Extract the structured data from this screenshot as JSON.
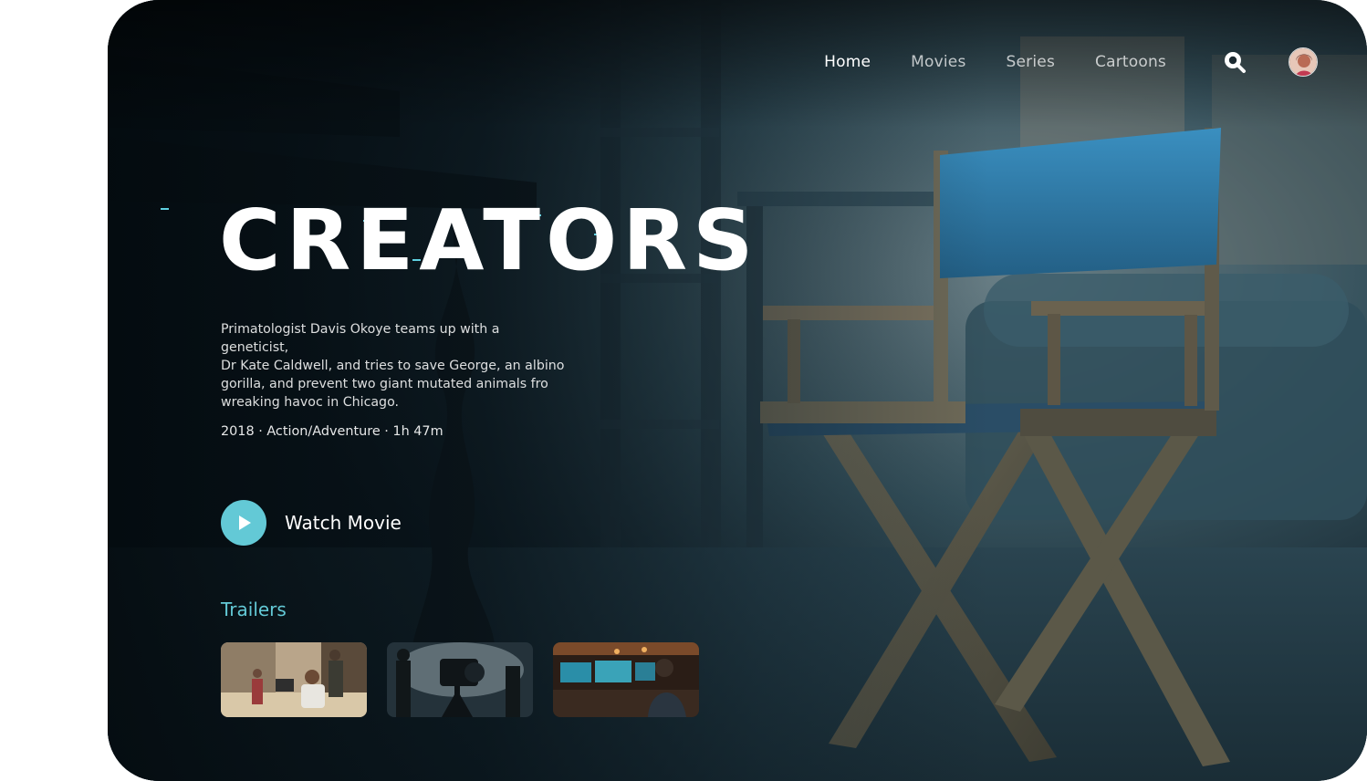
{
  "nav": {
    "items": [
      {
        "label": "Home",
        "active": true
      },
      {
        "label": "Movies",
        "active": false
      },
      {
        "label": "Series",
        "active": false
      },
      {
        "label": "Cartoons",
        "active": false
      }
    ],
    "search_icon": "search-icon",
    "avatar_icon": "user-avatar"
  },
  "hero": {
    "title": "CREATORS",
    "synopsis": "Primatologist Davis Okoye teams up with a geneticist,\nDr Kate Caldwell, and tries to save George, an albino\ngorilla, and prevent two giant mutated animals fro\n wreaking havoc in Chicago.",
    "meta": "2018 · Action/Adventure · 1h 47m",
    "watch_label": "Watch Movie",
    "play_icon": "play-icon"
  },
  "trailers": {
    "title": "Trailers",
    "items": [
      {
        "name": "trailer-film-crew"
      },
      {
        "name": "trailer-camera-set"
      },
      {
        "name": "trailer-editing-room"
      }
    ]
  },
  "colors": {
    "accent": "#63c9d6",
    "chair_canvas": "#2f7fae",
    "text": "#ffffff"
  }
}
